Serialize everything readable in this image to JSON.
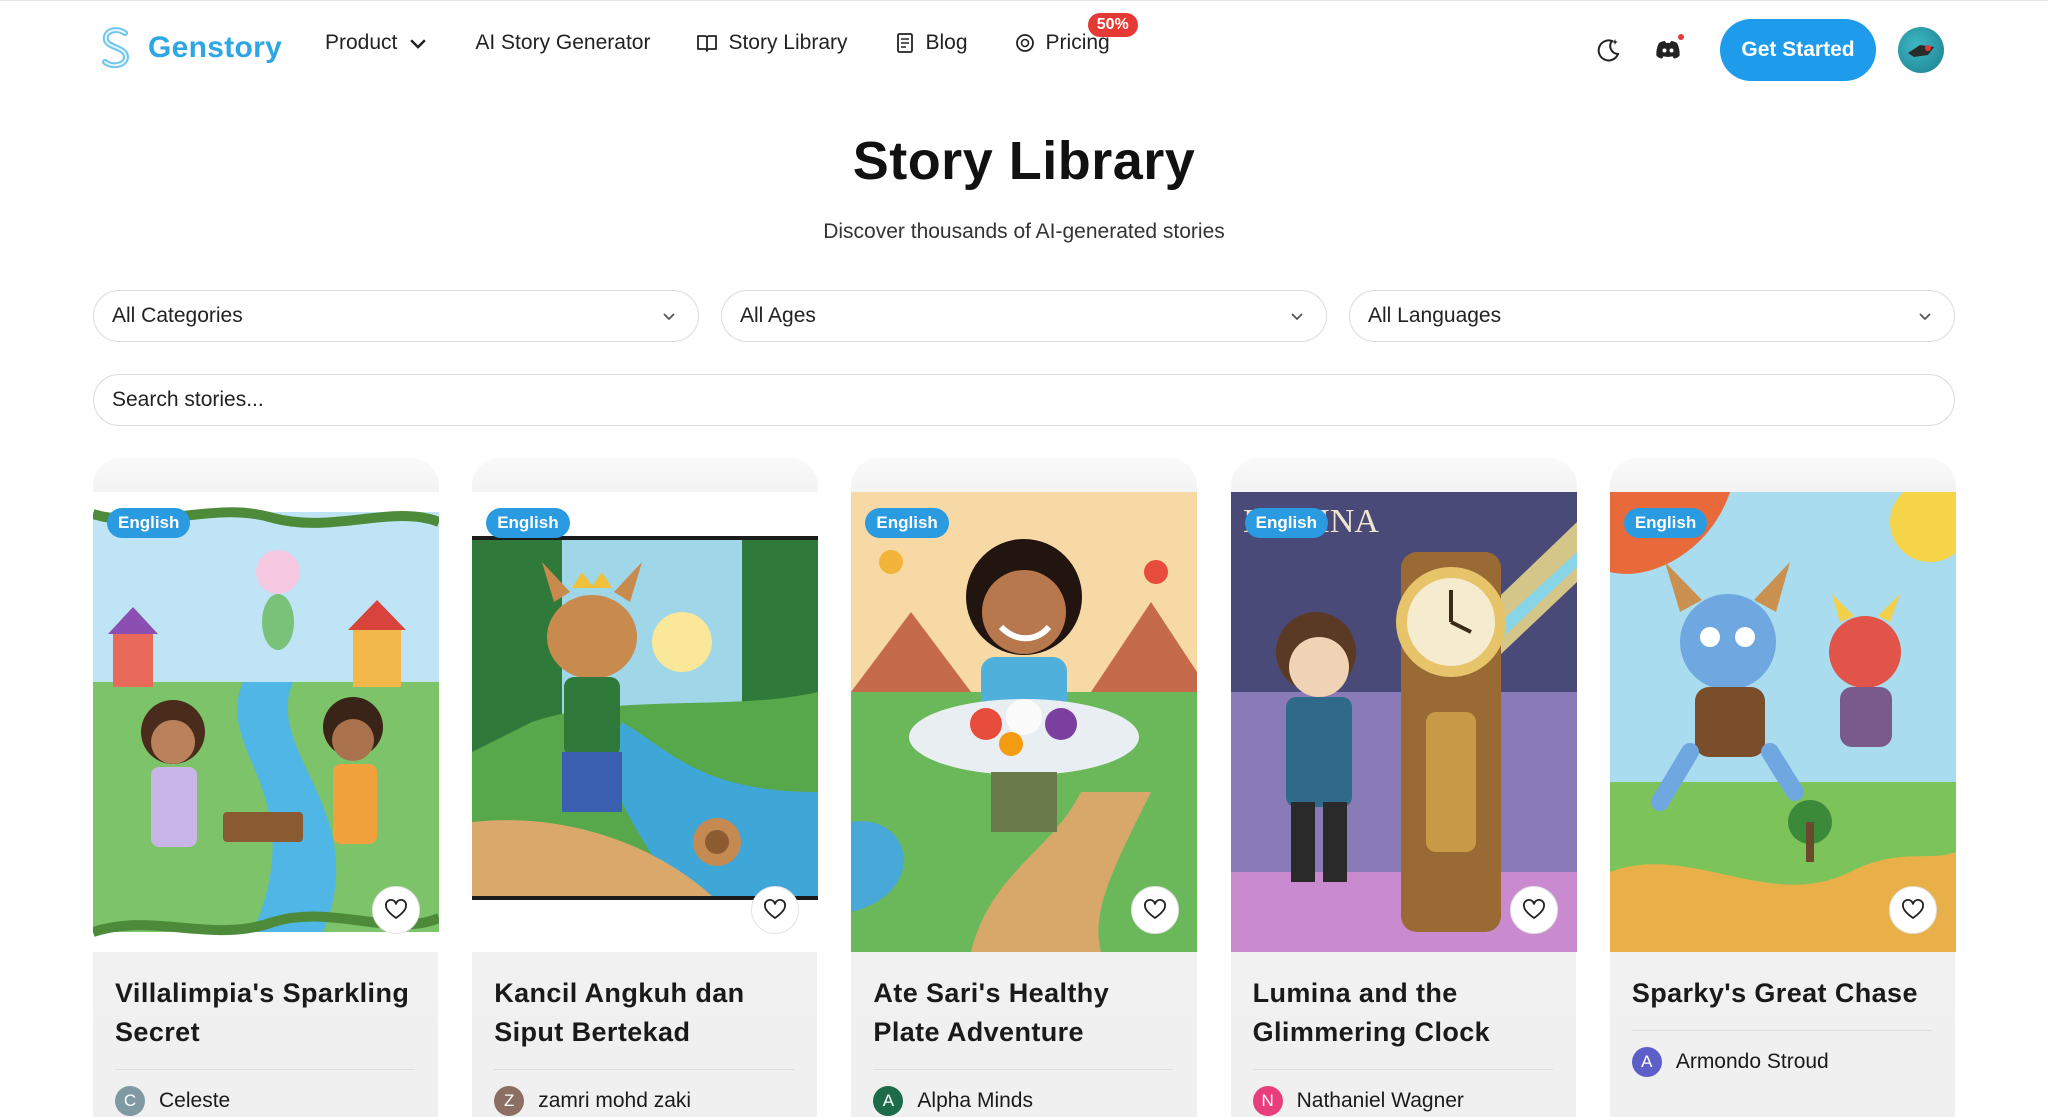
{
  "brand": {
    "name": "Genstory"
  },
  "nav": {
    "product": "Product",
    "ai_generator": "AI Story Generator",
    "story_library": "Story Library",
    "blog": "Blog",
    "pricing": "Pricing",
    "pricing_badge": "50%"
  },
  "header": {
    "cta": "Get Started"
  },
  "hero": {
    "title": "Story Library",
    "subtitle": "Discover thousands of AI-generated stories"
  },
  "filters": {
    "category": "All Categories",
    "age": "All Ages",
    "language": "All Languages",
    "search_placeholder": "Search stories..."
  },
  "stories": [
    {
      "language": "English",
      "title": "Villalimpia's Sparkling Secret",
      "author": "Celeste",
      "initial": "C",
      "avatar_color": "#7f9aa3"
    },
    {
      "language": "English",
      "title": "Kancil Angkuh dan Siput Bertekad",
      "author": "zamri mohd zaki",
      "initial": "Z",
      "avatar_color": "#8d6e63"
    },
    {
      "language": "English",
      "title": "Ate Sari's Healthy Plate Adventure",
      "author": "Alpha Minds",
      "initial": "A",
      "avatar_color": "#1e6b4a"
    },
    {
      "language": "English",
      "title": "Lumina and the Glimmering Clock",
      "author": "Nathaniel Wagner",
      "initial": "N",
      "avatar_color": "#e83e7c"
    },
    {
      "language": "English",
      "title": "Sparky's Great Chase",
      "author": "Armondo Stroud",
      "initial": "A",
      "avatar_color": "#5b5fc7"
    }
  ],
  "icons": {
    "theme": "moon-icon",
    "discord": "discord-icon",
    "favorite": "heart-icon"
  },
  "colors": {
    "accent": "#1e9bea",
    "badge": "#e53935",
    "brand": "#2ea6e6"
  }
}
